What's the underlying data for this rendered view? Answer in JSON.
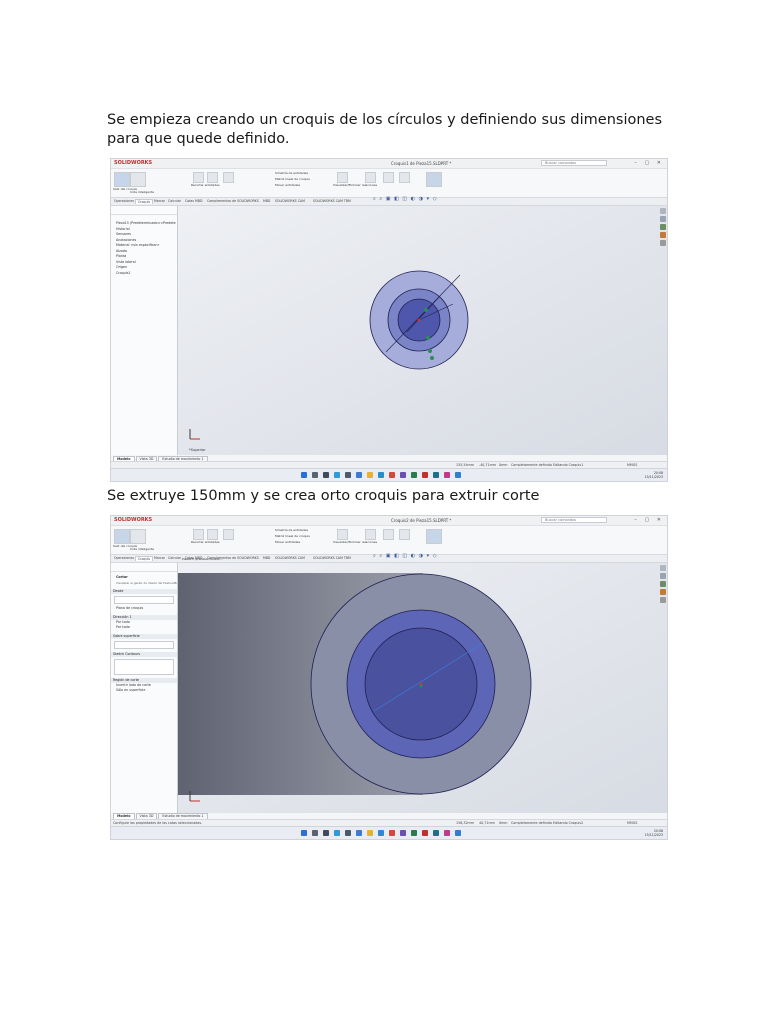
{
  "paragraphs": {
    "first": "Se empieza creando un croquis de los círculos y definiendo sus dimensiones para que quede definido.",
    "second": "Se extruye 150mm y se crea orto croquis para extruir corte"
  },
  "screenshot1": {
    "app_name": "SOLIDWORKS",
    "window_title": "Croquis1 de Pieza15.SLDPRT *",
    "search_placeholder": "Buscar comandos",
    "ribbon_labels": [
      "Salir del croquis",
      "Cota inteligente",
      "Recortar entidades",
      "Convertir entidades",
      "Equidistanciar entidades",
      "Simetría de entidades",
      "Matriz lineal de croquis",
      "Mover entidades",
      "Visualizar/Eliminar relaciones",
      "Reparar croquis",
      "Captura rápida",
      "Croquis rápido",
      "Instant 2D",
      "Contornos de croquis sombreados"
    ],
    "tabs": [
      "Operaciones",
      "Croquis",
      "Marcar",
      "Calcular",
      "Cotas MBD",
      "Complementos de SOLIDWORKS",
      "MBD",
      "SOLIDWORKS CAM",
      "SOLIDWORKS CAM TBM"
    ],
    "tree": [
      "Pieza15 (Predeterminado<<Predete",
      "Historial",
      "Sensores",
      "Anotaciones",
      "Material <sin especificar>",
      "Alzado",
      "Planta",
      "Vista lateral",
      "Origen",
      "Croquis1"
    ],
    "orientation_label": "*Superior",
    "bottom_tabs": [
      "Modelo",
      "Vista 3D",
      "Estudio de movimiento 1"
    ],
    "status": [
      "155,54mm",
      "-40,71mm",
      "0mm",
      "Completamente definido",
      "Editando Croquis1",
      "MMGS"
    ],
    "clock": [
      "20:08",
      "15/11/2023"
    ]
  },
  "screenshot2": {
    "app_name": "SOLIDWORKS",
    "window_title": "Croquis2 de Pieza15.SLDPRT *",
    "search_placeholder": "Buscar comandos",
    "ribbon_labels": [
      "Salir del croquis",
      "Cota inteligente",
      "Recortar entidades",
      "Convertir entidades",
      "Equidistanciar entidades",
      "Simetría de entidades",
      "Matriz lineal de croquis",
      "Mover entidades",
      "Visualizar/Eliminar relaciones",
      "Reparar croquis",
      "Captura rápida",
      "Croquis rápido",
      "Instant 2D",
      "Contornos de croquis sombreados"
    ],
    "tabs": [
      "Operaciones",
      "Croquis",
      "Marcar",
      "Calcular",
      "Cotas MBD",
      "Complementos de SOLIDWORKS",
      "MBD",
      "SOLIDWORKS CAM",
      "SOLIDWORKS CAM TBM"
    ],
    "breadcrumb": "Pieza15 (Predeterminado...",
    "feature_title": "Cortar",
    "tooltip": "Visualizar el gestor de diseño del FeatureManager",
    "panel_sections": [
      "Desde",
      "Dirección 1",
      "Sobre superficie",
      "Sketch Contours",
      "Región de corte"
    ],
    "panel_values": [
      "Plano de croquis",
      "Por todo",
      "Por todo",
      "Invertir lado de corte",
      "Sólo en superficie"
    ],
    "bottom_tabs": [
      "Modelo",
      "Vista 3D",
      "Estudio de movimiento 1"
    ],
    "status_left": "Configure las propiedades de las cotas seleccionadas.",
    "status": [
      "156,32mm",
      "40,71mm",
      "0mm",
      "Completamente definido",
      "Editando Croquis2",
      "MMGS"
    ],
    "clock": [
      "20:08",
      "15/11/2023"
    ]
  },
  "colors": {
    "outer_disk": "#a7addb",
    "mid_disk": "#7a84c7",
    "inner_disk": "#4f57ad",
    "dark_outline": "#1e2050",
    "extrude_body": "#7c7f8c",
    "extrude_face": "#8a8fa8",
    "accent_red": "#c0302e"
  }
}
